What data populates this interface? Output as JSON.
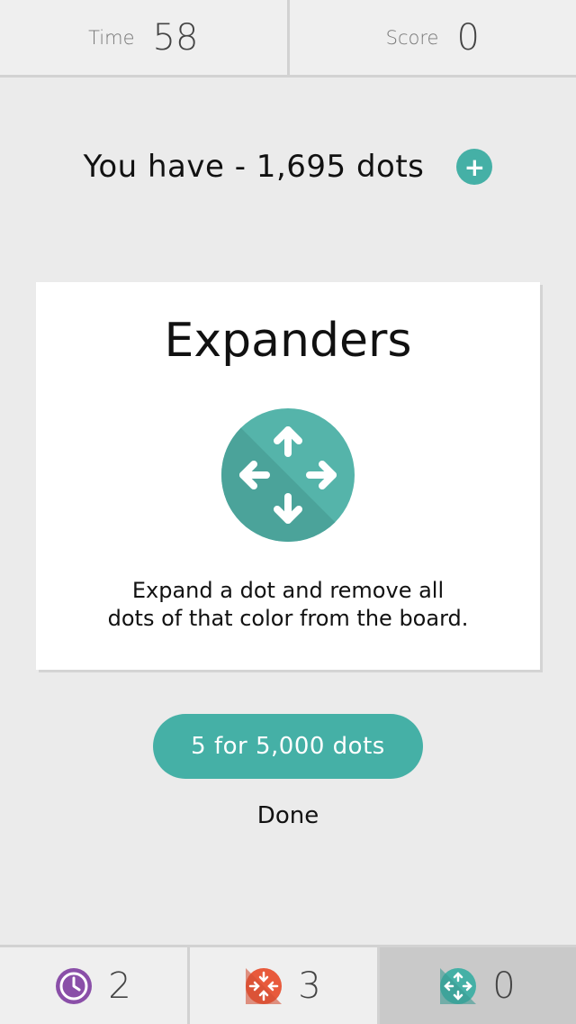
{
  "header": {
    "time_label": "Time",
    "time_value": "58",
    "score_label": "Score",
    "score_value": "0"
  },
  "dots": {
    "text": "You have - 1,695 dots",
    "add_icon": "plus-icon",
    "add_symbol": "+"
  },
  "card": {
    "title": "Expanders",
    "icon": "expander-arrows-icon",
    "description_line1": "Expand a dot and remove all",
    "description_line2": "dots of that color from the board."
  },
  "actions": {
    "buy_label": "5 for 5,000 dots",
    "done_label": "Done"
  },
  "powerups": [
    {
      "icon": "clock-icon",
      "count": "2",
      "color": "#8a4fa8"
    },
    {
      "icon": "shrinker-icon",
      "count": "3",
      "color": "#e85a3c"
    },
    {
      "icon": "expander-icon",
      "count": "0",
      "color": "#45b0a6"
    }
  ],
  "colors": {
    "accent": "#45b0a6",
    "background": "#ebebeb"
  }
}
